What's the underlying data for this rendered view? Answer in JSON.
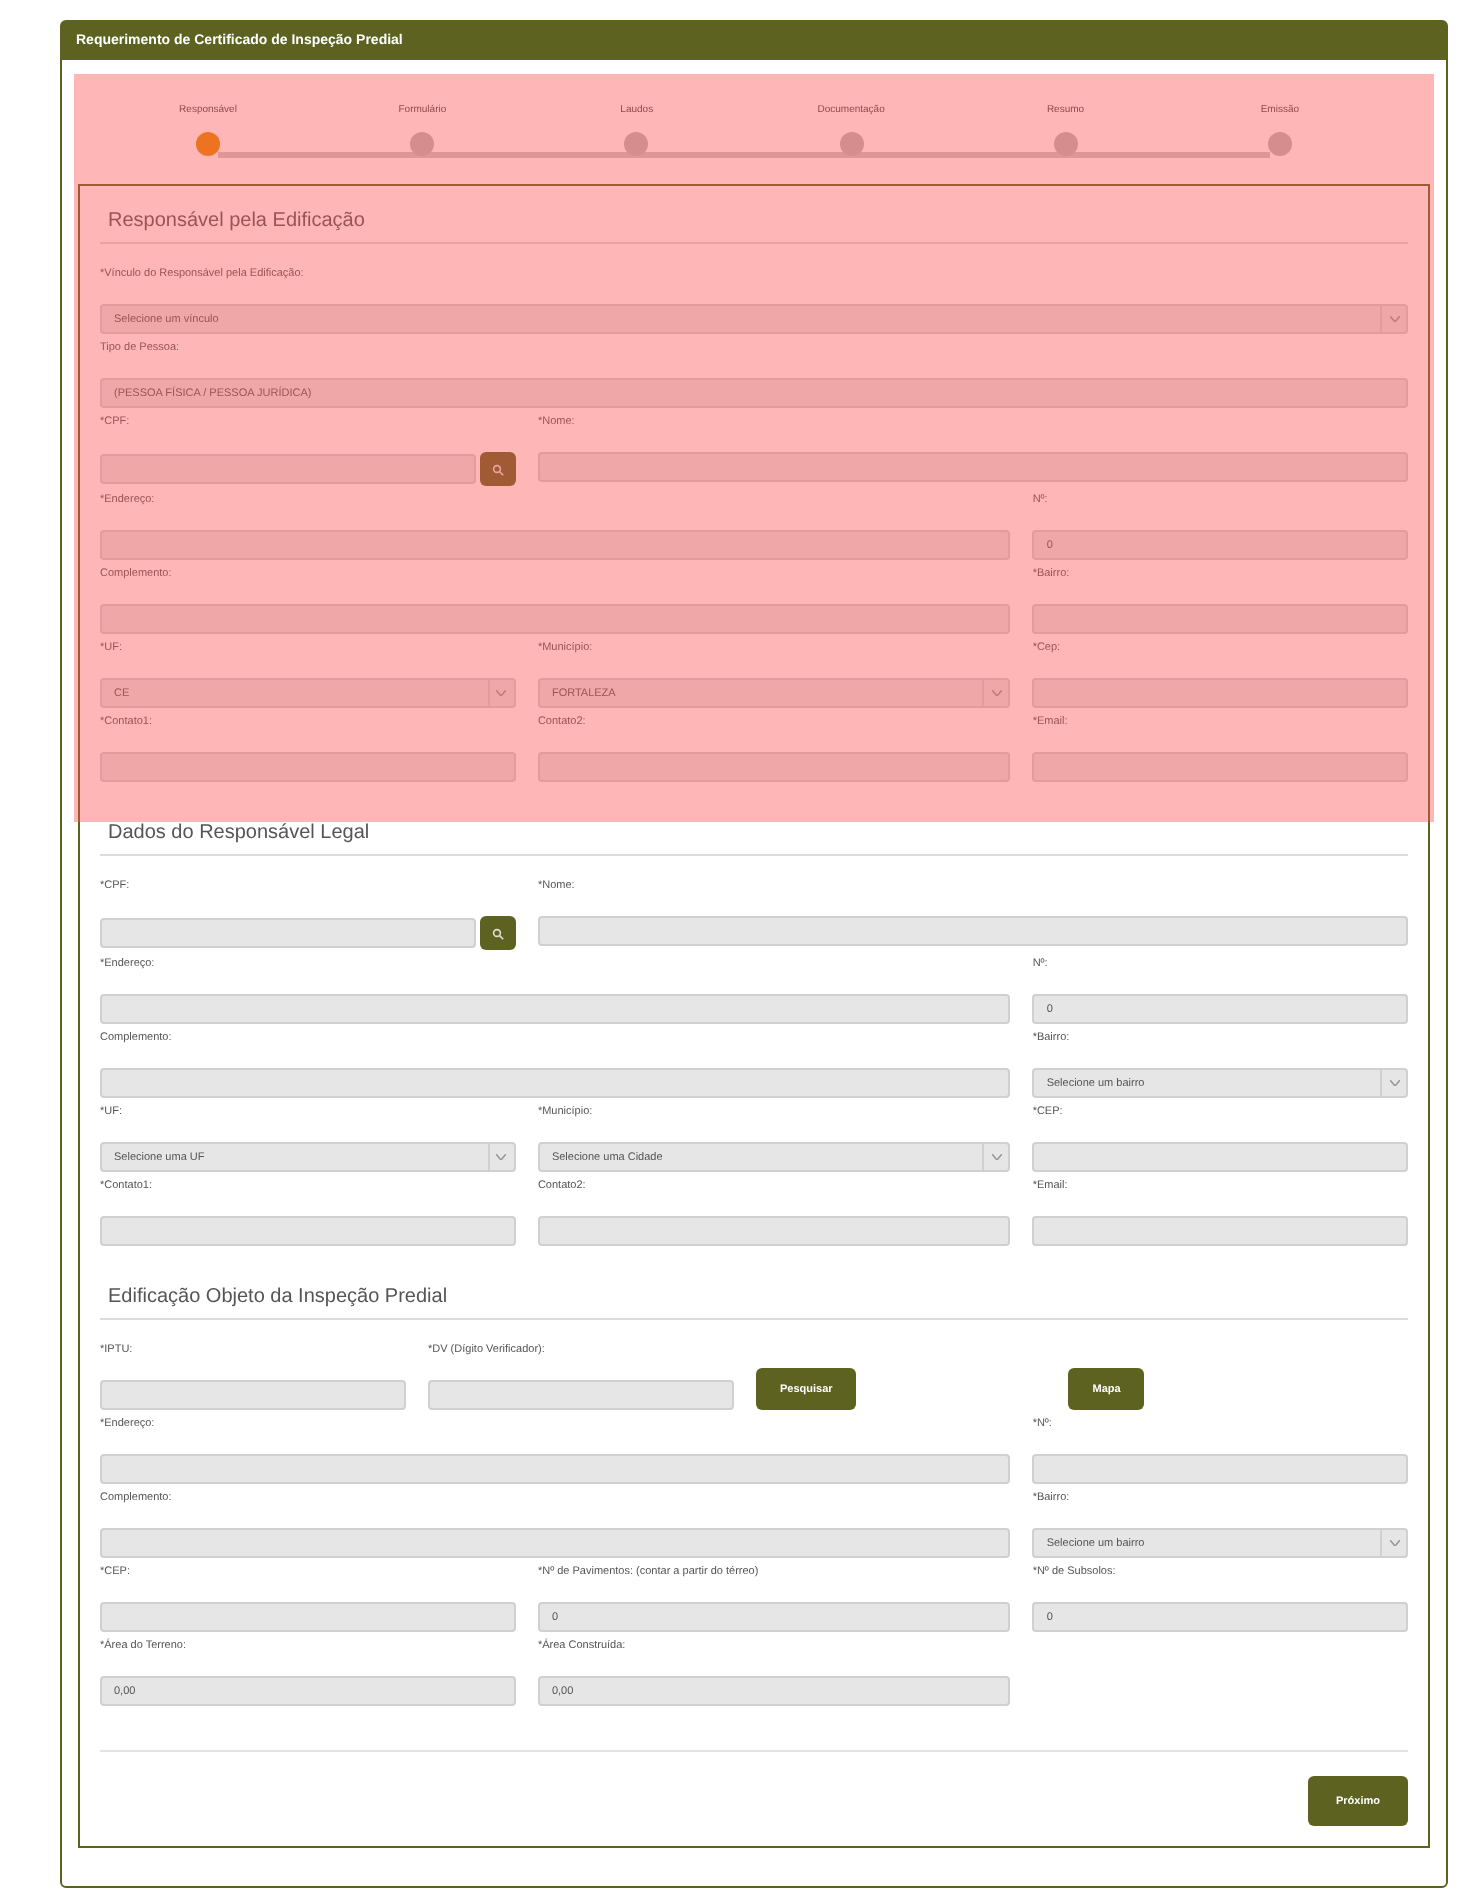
{
  "window": {
    "title": "Requerimento de Certificado de Inspeção Predial"
  },
  "highlight_overlay": true,
  "steps": [
    {
      "label": "Responsável",
      "selected": true
    },
    {
      "label": "Formulário",
      "selected": false
    },
    {
      "label": "Laudos",
      "selected": false
    },
    {
      "label": "Documentação",
      "selected": false
    },
    {
      "label": "Resumo",
      "selected": false
    },
    {
      "label": "Emissão",
      "selected": false
    }
  ],
  "sections": [
    {
      "title": "Responsável pela Edificação",
      "rows": [
        [
          {
            "label": "*Vínculo do Responsável pela Edificação:",
            "kind": "select",
            "value": "Selecione um vínculo"
          }
        ],
        [
          {
            "label": "Tipo de Pessoa:",
            "kind": "text",
            "value": "(PESSOA FÍSICA / PESSOA JURÍDICA)"
          }
        ],
        [
          {
            "label": "*CPF:",
            "kind": "search"
          },
          {
            "label": "*Nome:",
            "kind": "text"
          }
        ],
        [
          {
            "label": "*Endereço:",
            "kind": "text"
          },
          {
            "label": "Nº:",
            "kind": "text",
            "value": "0"
          }
        ],
        [
          {
            "label": "Complemento:",
            "kind": "text"
          },
          {
            "label": "*Bairro:",
            "kind": "text"
          }
        ],
        [
          {
            "label": "*UF:",
            "kind": "select",
            "value": "CE"
          },
          {
            "label": "*Município:",
            "kind": "select",
            "value": "FORTALEZA"
          },
          {
            "label": "*Cep:",
            "kind": "text"
          }
        ],
        [
          {
            "label": "*Contato1:",
            "kind": "text"
          },
          {
            "label": "Contato2:",
            "kind": "text"
          },
          {
            "label": "*Email:",
            "kind": "text"
          }
        ]
      ]
    },
    {
      "title": "Dados do Responsável Legal",
      "rows": [
        [
          {
            "label": "*CPF:",
            "kind": "search"
          },
          {
            "label": "*Nome:",
            "kind": "text"
          }
        ],
        [
          {
            "label": "*Endereço:",
            "kind": "text"
          },
          {
            "label": "Nº:",
            "kind": "text",
            "value": "0"
          }
        ],
        [
          {
            "label": "Complemento:",
            "kind": "text"
          },
          {
            "label": "*Bairro:",
            "kind": "select",
            "value": "Selecione um bairro"
          }
        ],
        [
          {
            "label": "*UF:",
            "kind": "select",
            "value": "Selecione uma UF"
          },
          {
            "label": "*Município:",
            "kind": "select",
            "value": "Selecione uma Cidade"
          },
          {
            "label": "*CEP:",
            "kind": "text"
          }
        ],
        [
          {
            "label": "*Contato1:",
            "kind": "text"
          },
          {
            "label": "Contato2:",
            "kind": "text"
          },
          {
            "label": "*Email:",
            "kind": "text"
          }
        ]
      ]
    },
    {
      "title": "Edificação Objeto da Inspeção Predial",
      "lookup": {
        "fields": [
          {
            "label": "*IPTU:"
          },
          {
            "label": "*DV (Dígito Verificador):"
          }
        ],
        "buttons": [
          "Pesquisar",
          "Mapa"
        ]
      },
      "rows": [
        [
          {
            "label": "*Endereço:",
            "kind": "text"
          },
          {
            "label": "*Nº:",
            "kind": "text"
          }
        ],
        [
          {
            "label": "Complemento:",
            "kind": "text"
          },
          {
            "label": "*Bairro:",
            "kind": "select",
            "value": "Selecione um bairro"
          }
        ],
        [
          {
            "label": "*CEP:",
            "kind": "text"
          },
          {
            "label": "*Nº de Pavimentos: (contar a partir do térreo)",
            "kind": "text",
            "value": "0"
          },
          {
            "label": "*Nº de Subsolos:",
            "kind": "text",
            "value": "0"
          }
        ],
        [
          {
            "label": "*Área do Terreno:",
            "kind": "text",
            "value": "0,00"
          },
          {
            "label": "*Área Construída:",
            "kind": "text",
            "value": "0,00"
          }
        ]
      ]
    }
  ],
  "next_button": "Próximo"
}
